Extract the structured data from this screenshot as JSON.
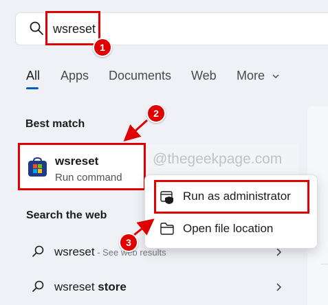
{
  "search": {
    "query": "wsreset"
  },
  "tabs": [
    {
      "label": "All"
    },
    {
      "label": "Apps"
    },
    {
      "label": "Documents"
    },
    {
      "label": "Web"
    },
    {
      "label": "More"
    }
  ],
  "best_match": {
    "heading": "Best match",
    "title": "wsreset",
    "subtitle": "Run command"
  },
  "watermark": "@thegeekpage.com",
  "context_menu": {
    "items": [
      {
        "label": "Run as administrator",
        "icon": "shield-icon"
      },
      {
        "label": "Open file location",
        "icon": "folder-icon"
      }
    ]
  },
  "web": {
    "heading": "Search the web",
    "rows": [
      {
        "term": "wsreset",
        "suffix": " - See web results"
      },
      {
        "term": "wsreset",
        "bold": " store"
      }
    ]
  },
  "annotations": {
    "badge1": "1",
    "badge2": "2",
    "badge3": "3"
  },
  "colors": {
    "accent": "#005fb8",
    "highlight": "#e00000"
  }
}
